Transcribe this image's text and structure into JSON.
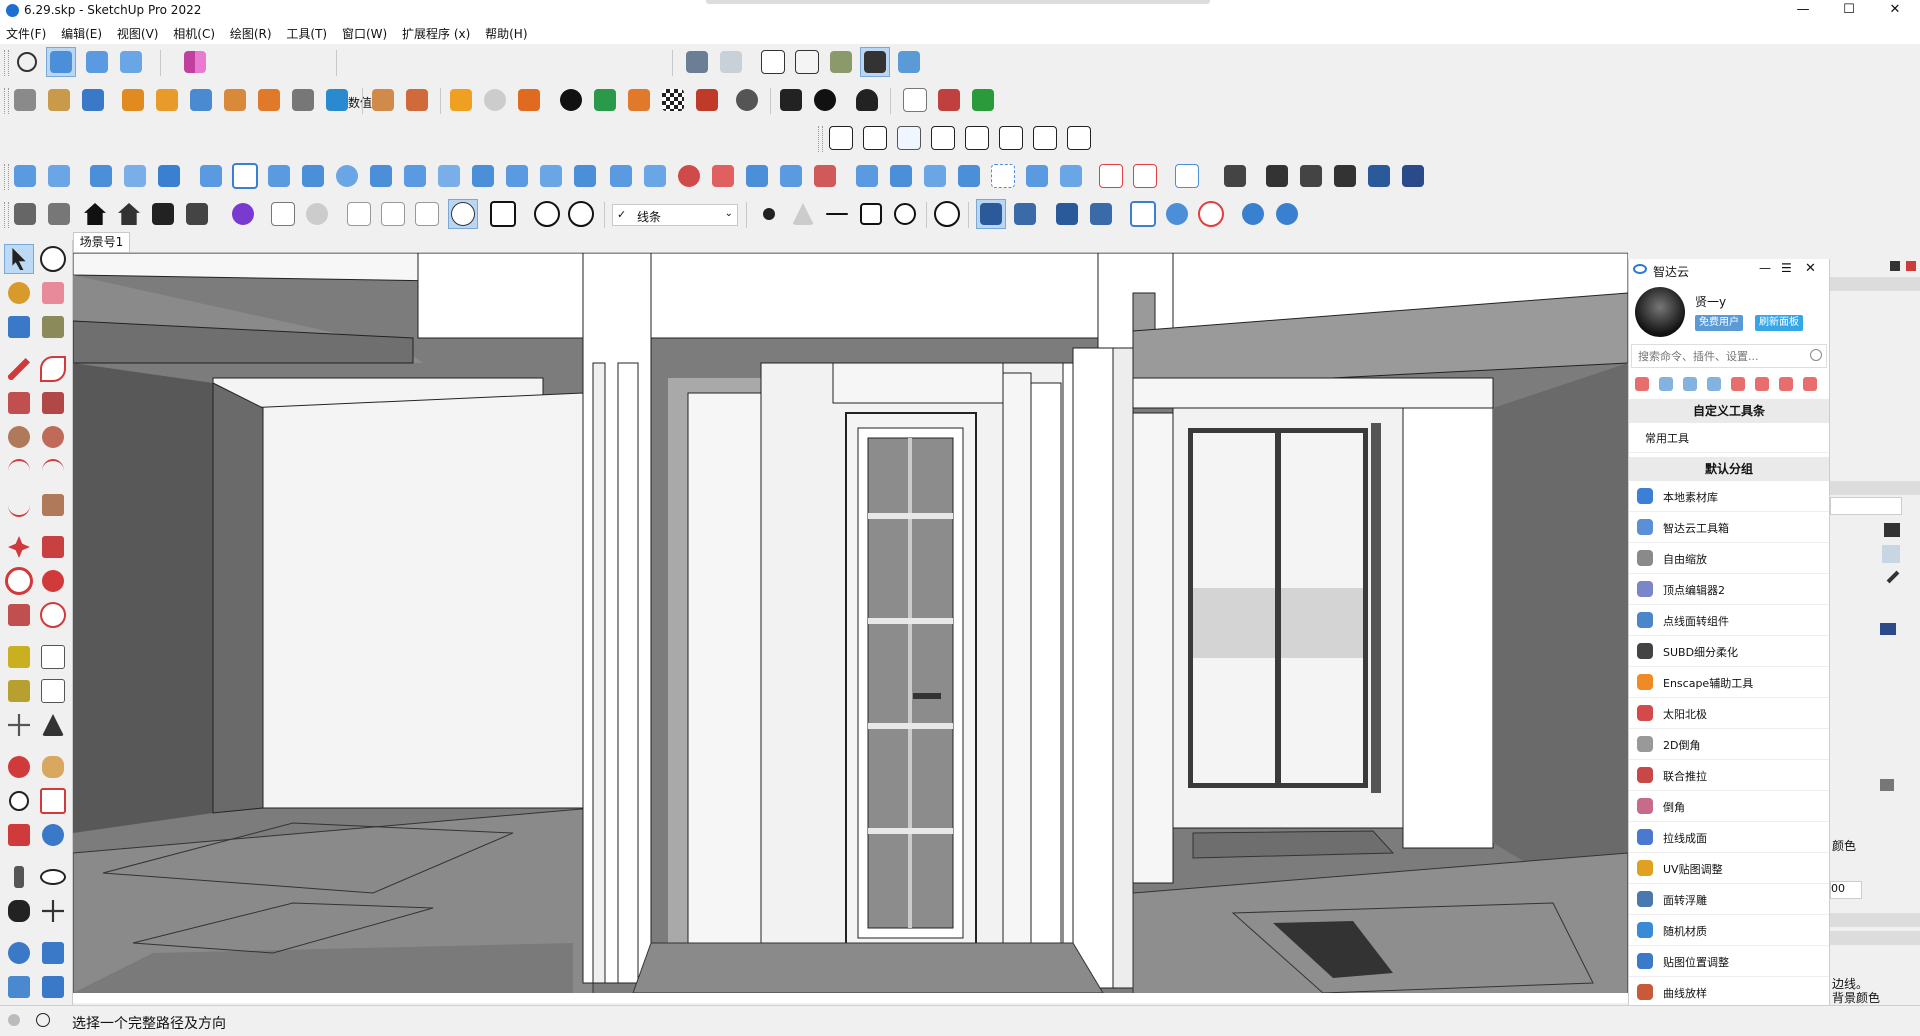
{
  "window": {
    "title": "6.29.skp - SketchUp Pro 2022",
    "minimize": "—",
    "maximize": "☐",
    "close": "✕"
  },
  "menu": [
    "文件(F)",
    "编辑(E)",
    "视图(V)",
    "相机(C)",
    "绘图(R)",
    "工具(T)",
    "窗口(W)",
    "扩展程序 (x)",
    "帮助(H)"
  ],
  "toolbar": {
    "value_label": "数值",
    "style_dropdown": "线条",
    "style_check": "✓"
  },
  "scene_tab": "场景号1",
  "status": {
    "message": "选择一个完整路径及方向"
  },
  "panel": {
    "title": "智达云",
    "username": "贤一y",
    "badge_free": "免费用户",
    "badge_refresh": "刷新面板",
    "search_placeholder": "搜索命令、插件、设置...",
    "custom_toolbar_heading": "自定义工具条",
    "common_tools": "常用工具",
    "default_group_heading": "默认分组",
    "items": [
      {
        "label": "本地素材库",
        "color": "#3b7fd6"
      },
      {
        "label": "智达云工具箱",
        "color": "#5b8fd8"
      },
      {
        "label": "自由缩放",
        "color": "#8a8a8a"
      },
      {
        "label": "顶点编辑器2",
        "color": "#7a86c8"
      },
      {
        "label": "点线面转组件",
        "color": "#4a86c8"
      },
      {
        "label": "SUBD细分柔化",
        "color": "#444444"
      },
      {
        "label": "Enscape辅助工具",
        "color": "#f08a24"
      },
      {
        "label": "太阳北极",
        "color": "#d44a4a"
      },
      {
        "label": "2D倒角",
        "color": "#999999"
      },
      {
        "label": "联合推拉",
        "color": "#c84848"
      },
      {
        "label": "倒角",
        "color": "#c86a8a"
      },
      {
        "label": "拉线成面",
        "color": "#4a7ad0"
      },
      {
        "label": "UV贴图调整",
        "color": "#e0a020"
      },
      {
        "label": "面转浮雕",
        "color": "#4a78b0"
      },
      {
        "label": "随机材质",
        "color": "#3a8ad8"
      },
      {
        "label": "贴图位置调整",
        "color": "#3a7ac8"
      },
      {
        "label": "曲线放样",
        "color": "#c85a3a"
      }
    ]
  },
  "right_dock": {
    "label_color": "颜色",
    "label_edges": "边线。",
    "label_bg": "背景颜色",
    "spin_value": "00"
  },
  "colors": {
    "accent": "#1e6fd0",
    "selected": "#b9d7f3",
    "badge_free": "#5a9ad6",
    "badge_refresh": "#35a7e8"
  }
}
